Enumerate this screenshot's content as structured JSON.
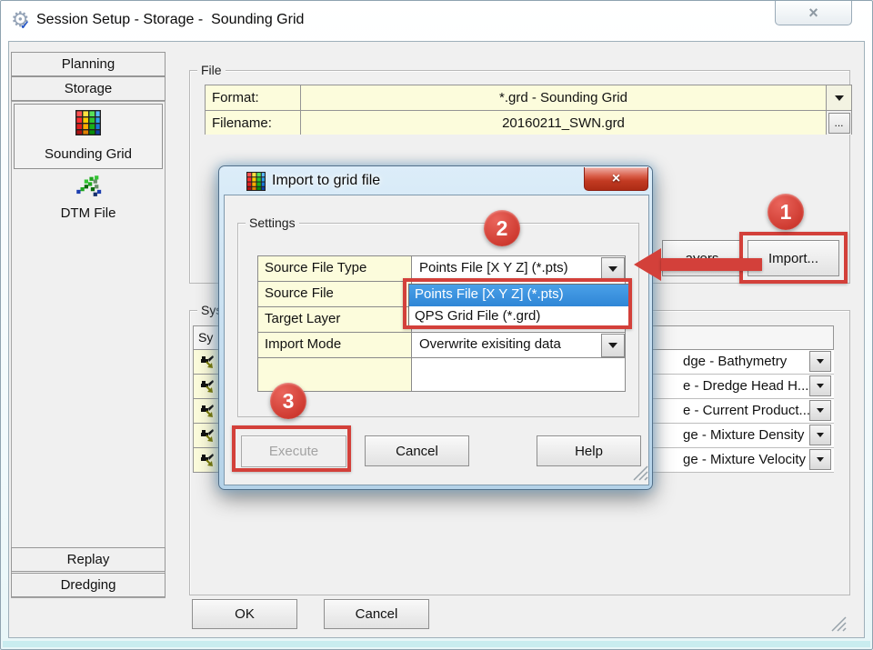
{
  "window": {
    "title": "Session Setup - Storage -  Sounding Grid",
    "close": "×"
  },
  "sidebar": {
    "planning": "Planning",
    "storage": "Storage",
    "sounding_grid": "Sounding Grid",
    "dtm_file": "DTM File",
    "replay": "Replay",
    "dredging": "Dredging"
  },
  "file_group": {
    "label": "File",
    "format_label": "Format:",
    "format_value": "*.grd - Sounding Grid",
    "filename_label": "Filename:",
    "filename_value": "20160211_SWN.grd",
    "browse": "...",
    "partial_button": "ayers",
    "import": "Import..."
  },
  "system_group": {
    "label": "Syst",
    "header": "Sy",
    "layers": [
      "dge - Bathymetry",
      "e - Dredge Head H...",
      "e - Current Product...",
      "ge - Mixture Density",
      "ge - Mixture Velocity"
    ]
  },
  "footer": {
    "ok": "OK",
    "cancel": "Cancel"
  },
  "dialog": {
    "title": "Import to grid file",
    "close": "×",
    "settings_label": "Settings",
    "rows": [
      {
        "label": "Source File Type",
        "value": "Points File [X Y Z] (*.pts)"
      },
      {
        "label": "Source File",
        "value": ""
      },
      {
        "label": "Target Layer",
        "value": ""
      },
      {
        "label": "Import Mode",
        "value": "Overwrite exisiting data"
      }
    ],
    "dropdown": {
      "items": [
        {
          "label": "Points File [X Y Z] (*.pts)",
          "selected": true
        },
        {
          "label": "QPS Grid File (*.grd)",
          "selected": false
        }
      ]
    },
    "execute": "Execute",
    "cancel": "Cancel",
    "help": "Help"
  },
  "annotations": {
    "step1": "1",
    "step2": "2",
    "step3": "3"
  },
  "colors": {
    "annotation_red": "#d3403a",
    "selection_blue": "#3c95e0",
    "cell_yellow": "#fcfcdc"
  }
}
